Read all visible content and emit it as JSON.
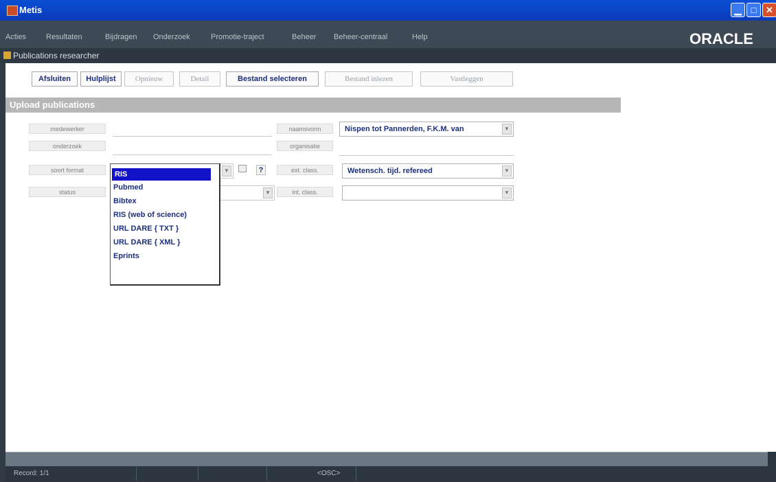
{
  "window": {
    "title": "Metis"
  },
  "menu": [
    "Acties",
    "Resultaten",
    "Bijdragen",
    "Onderzoek",
    "Promotie-traject",
    "Beheer",
    "Beheer-centraal",
    "Help"
  ],
  "brand": "ORACLE",
  "form": {
    "title": "Publications researcher"
  },
  "toolbar": {
    "afsluiten": "Afsluiten",
    "hulplijst": "Hulplijst",
    "opnieuw": "Opnieuw",
    "detail": "Detail",
    "bestand_selecteren": "Bestand selecteren",
    "bestand_inlezen": "Bestand inlezen",
    "vastleggen": "Vastleggen"
  },
  "section": {
    "title": "Upload publications"
  },
  "fields": {
    "medewerker_label": "medewerker",
    "onderzoek_label": "onderzoek",
    "soort_format_label": "soort format",
    "status_label": "status",
    "naamsvorm_label": "naamsvorm",
    "naamsvorm_value": "Nispen tot Pannerden, F.K.M. van",
    "organisatie_label": "organisatie",
    "ext_class_label": "ext. class.",
    "ext_class_value": "Wetensch. tijd. refereed",
    "int_class_label": "int. class.",
    "help_glyph": "?"
  },
  "format_options": [
    "RIS",
    "Pubmed",
    "Bibtex",
    "RIS (web of science)",
    "URL DARE { TXT }",
    "URL DARE { XML }",
    "Eprints"
  ],
  "format_selected": "RIS",
  "status": {
    "record": "Record: 1/1",
    "osc": "<OSC>"
  }
}
